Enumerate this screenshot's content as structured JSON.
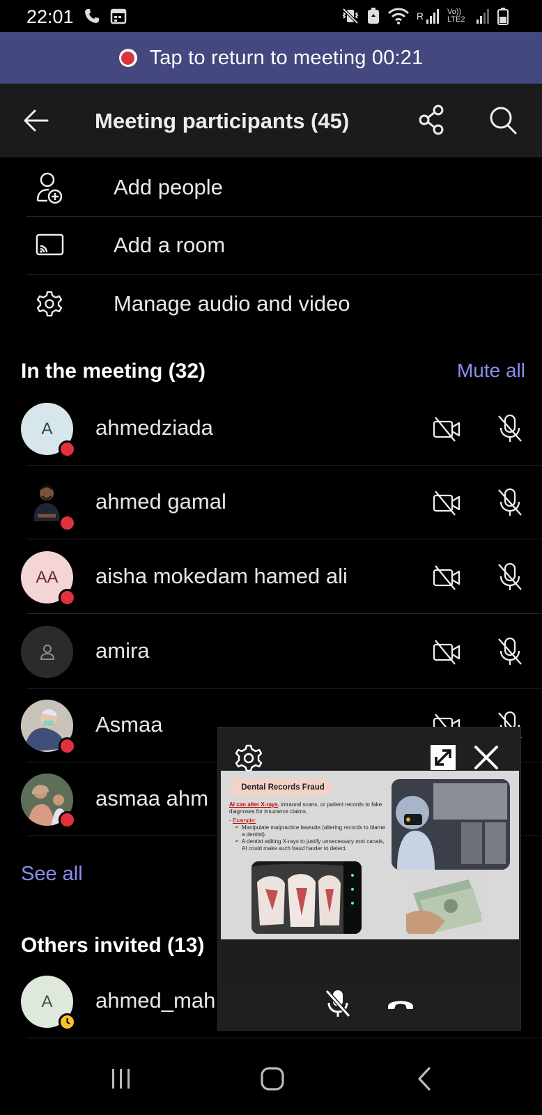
{
  "status_bar": {
    "time": "22:01",
    "sim_label": "R",
    "network_label": "Vo)) LTE2"
  },
  "banner": {
    "text": "Tap to return to meeting 00:21"
  },
  "header": {
    "title": "Meeting participants (45)"
  },
  "actions": [
    {
      "label": "Add people",
      "icon": "add-person-icon"
    },
    {
      "label": "Add a room",
      "icon": "cast-icon"
    },
    {
      "label": "Manage audio and video",
      "icon": "gear-icon"
    }
  ],
  "in_meeting": {
    "title": "In the meeting (32)",
    "mute_all": "Mute all",
    "participants": [
      {
        "name": "ahmedziada",
        "initials": "A",
        "avatar_bg": "#d6e6ea",
        "avatar_fg": "#2d4a50",
        "presence": "busy"
      },
      {
        "name": "ahmed gamal",
        "initials": "",
        "avatar_bg": "#000000",
        "avatar_fg": "#ffffff",
        "presence": "busy"
      },
      {
        "name": "aisha mokedam hamed ali",
        "initials": "AA",
        "avatar_bg": "#f3d4d7",
        "avatar_fg": "#6b2a33",
        "presence": "busy"
      },
      {
        "name": "amira",
        "initials": "",
        "avatar_bg": "#2b2b2b",
        "avatar_fg": "#8e8e8e",
        "presence": "none"
      },
      {
        "name": "Asmaa",
        "initials": "",
        "avatar_bg": "#8a8aa0",
        "avatar_fg": "#ffffff",
        "presence": "busy"
      },
      {
        "name": "asmaa ahm",
        "initials": "",
        "avatar_bg": "#6f7f68",
        "avatar_fg": "#ffffff",
        "presence": "busy"
      }
    ],
    "see_all": "See all"
  },
  "others_invited": {
    "title": "Others invited (13)",
    "participants": [
      {
        "name": "ahmed_mah",
        "initials": "A",
        "avatar_bg": "#dfe8dc",
        "avatar_fg": "#3a5a37",
        "presence": "away"
      }
    ]
  },
  "pip": {
    "slide": {
      "title": "Dental Records Fraud",
      "lead_highlight": "AI can alter X-rays",
      "lead_rest": ", intraoral scans, or patient records to fake diagnoses for insurance claims.",
      "example_label": "Example:",
      "bullets": [
        "Manipulate malpractice lawsuits (altering records to blame a dentist).",
        "A dentist editing X-rays to justify unnecessary root canals, AI could make such fraud harder to detect."
      ]
    }
  },
  "colors": {
    "banner": "#45477f",
    "accent_link": "#8b8ef0",
    "busy": "#e0323d",
    "away": "#f5c42a",
    "header_bg": "#1b1b1b"
  }
}
